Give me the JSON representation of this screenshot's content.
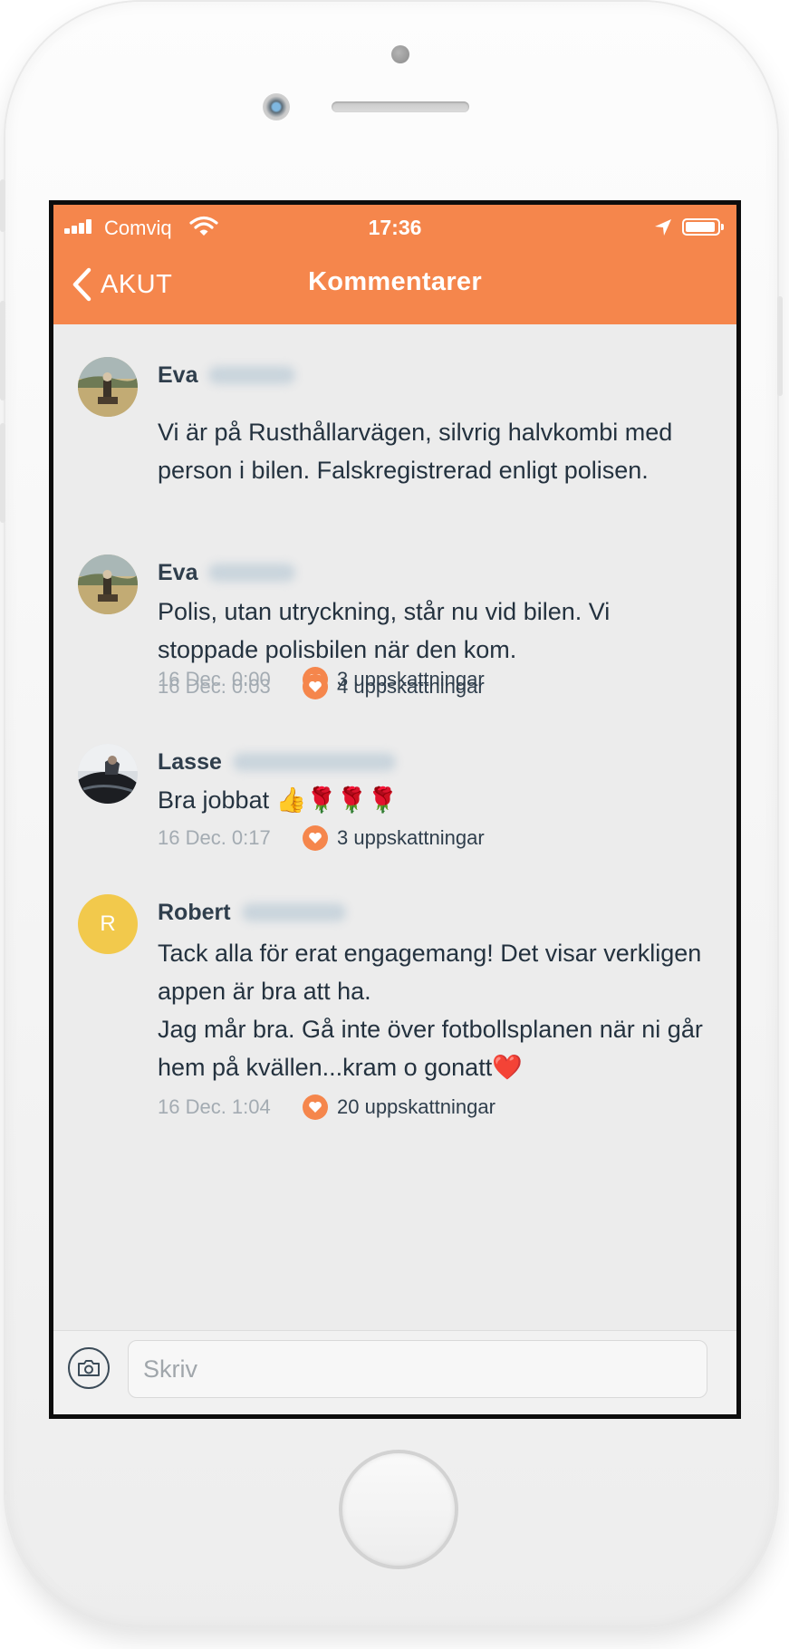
{
  "status_bar": {
    "carrier": "Comviq",
    "time": "17:36",
    "battery_level": 0.95,
    "signal_bars": 4
  },
  "nav": {
    "back_label": "AKUT",
    "title": "Kommentarer"
  },
  "colors": {
    "accent": "#f5864c",
    "background": "#ececec",
    "text": "#24323f",
    "muted": "#a3abb2",
    "avatar_letter_bg": "#f2c94c"
  },
  "comments": [
    {
      "name": "Eva",
      "avatar": "photo-rider-icon",
      "text": "Vi är på Rusthållarvägen, silvrig halvkombi med person i bilen. Falskregistrerad enligt polisen.",
      "date": "16 Dec. 0:00",
      "likes": "3 uppskattningar"
    },
    {
      "name": "Eva",
      "avatar": "photo-rider-icon",
      "text": "Polis, utan utryckning, står nu vid bilen. Vi stoppade polisbilen när den kom.",
      "date": "16 Dec. 0:03",
      "likes": "4 uppskattningar"
    },
    {
      "name": "Lasse",
      "avatar": "photo-car-icon",
      "text": "Bra jobbat 👍🌹🌹🌹",
      "date": "16 Dec. 0:17",
      "likes": "3 uppskattningar"
    },
    {
      "name": "Robert",
      "avatar_letter": "R",
      "text": "Tack alla för erat engagemang! Det visar verkligen appen är bra att ha.\nJag mår bra. Gå inte över fotbollsplanen när ni går hem på kvällen...kram o gonatt❤️",
      "date": "16 Dec. 1:04",
      "likes": "20 uppskattningar"
    }
  ],
  "composer": {
    "placeholder": "Skriv",
    "camera_icon": "camera-icon"
  }
}
